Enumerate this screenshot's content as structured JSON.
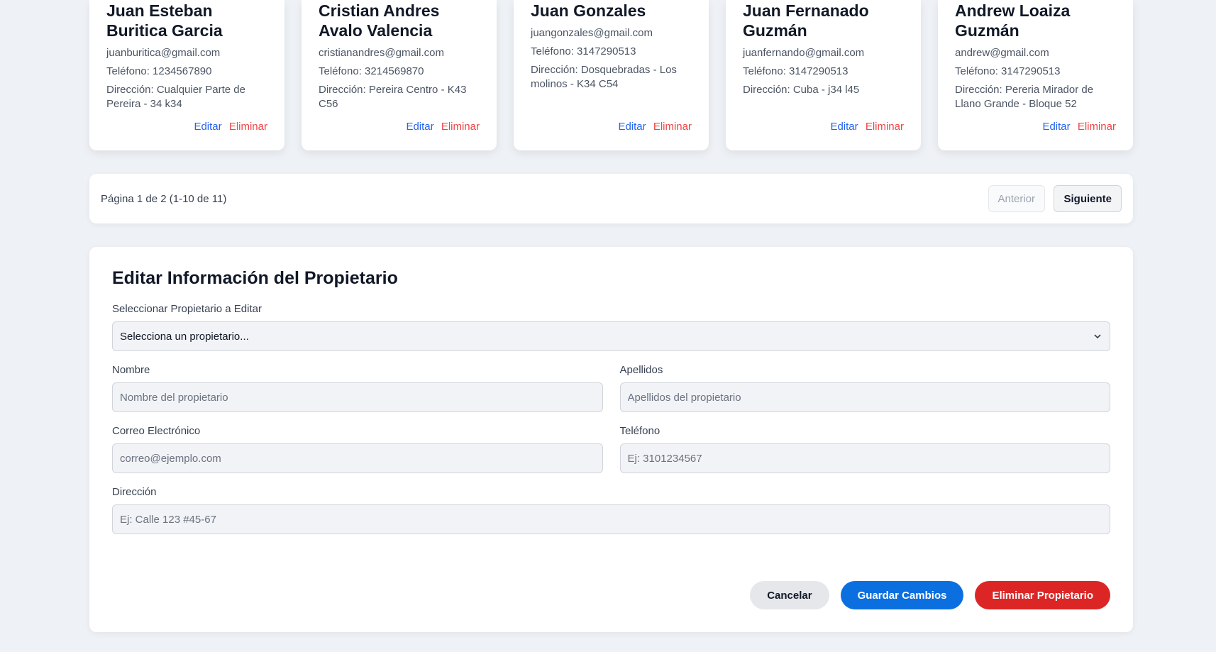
{
  "cards": [
    {
      "name": "Juan Esteban Buritica Garcia",
      "email": "juanburitica@gmail.com",
      "phone": "Teléfono: 1234567890",
      "address": "Dirección: Cualquier Parte de Pereira - 34 k34"
    },
    {
      "name": "Cristian Andres Avalo Valencia",
      "email": "cristianandres@gmail.com",
      "phone": "Teléfono: 3214569870",
      "address": "Dirección: Pereira Centro - K43 C56"
    },
    {
      "name": "Juan Gonzales",
      "email": "juangonzales@gmail.com",
      "phone": "Teléfono: 3147290513",
      "address": "Dirección: Dosquebradas - Los molinos - K34 C54"
    },
    {
      "name": "Juan Fernanado Guzmán",
      "email": "juanfernando@gmail.com",
      "phone": "Teléfono: 3147290513",
      "address": "Dirección: Cuba - j34 l45"
    },
    {
      "name": "Andrew Loaiza Guzmán",
      "email": "andrew@gmail.com",
      "phone": "Teléfono: 3147290513",
      "address": "Dirección: Pereria Mirador de Llano Grande - Bloque 52"
    }
  ],
  "card_actions": {
    "edit": "Editar",
    "delete": "Eliminar"
  },
  "pagination": {
    "info": "Página 1 de 2 (1-10 de 11)",
    "prev": "Anterior",
    "next": "Siguiente"
  },
  "form": {
    "title": "Editar Información del Propietario",
    "select_label": "Seleccionar Propietario a Editar",
    "select_value": "Selecciona un propietario...",
    "nombre_label": "Nombre",
    "nombre_placeholder": "Nombre del propietario",
    "apellidos_label": "Apellidos",
    "apellidos_placeholder": "Apellidos del propietario",
    "correo_label": "Correo Electrónico",
    "correo_placeholder": "correo@ejemplo.com",
    "telefono_label": "Teléfono",
    "telefono_placeholder": "Ej: 3101234567",
    "direccion_label": "Dirección",
    "direccion_placeholder": "Ej: Calle 123 #45-67",
    "cancel": "Cancelar",
    "save": "Guardar Cambios",
    "delete": "Eliminar Propietario"
  }
}
